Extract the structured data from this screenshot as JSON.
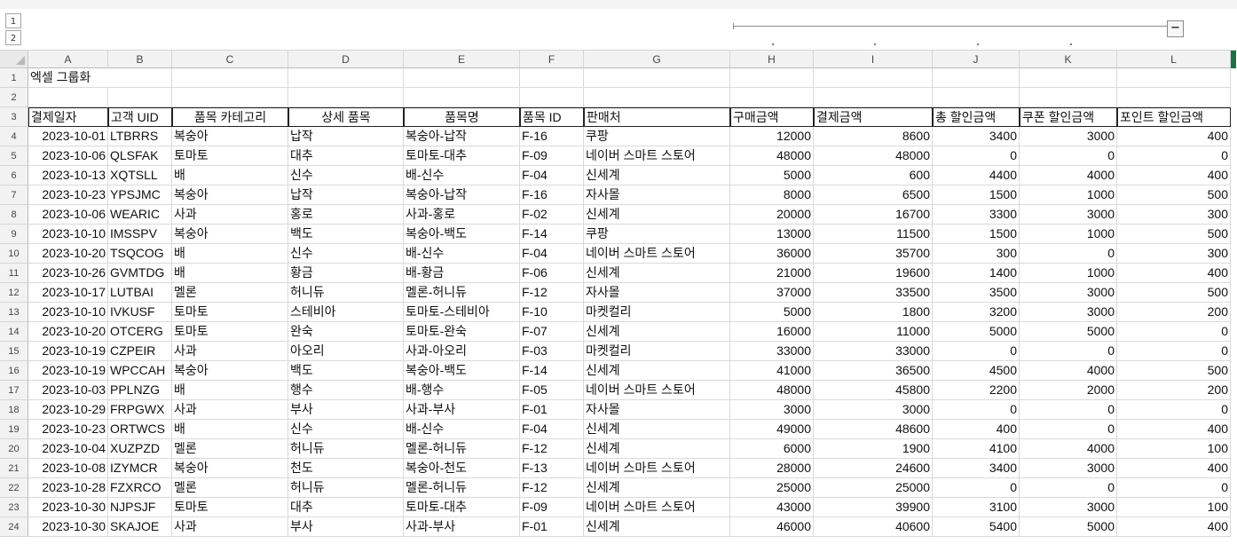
{
  "outline": {
    "levels": [
      "1",
      "2"
    ],
    "collapse_symbol": "−"
  },
  "columns": [
    "A",
    "B",
    "C",
    "D",
    "E",
    "F",
    "G",
    "H",
    "I",
    "J",
    "K",
    "L"
  ],
  "row_numbers": [
    "1",
    "2",
    "3",
    "4",
    "5",
    "6",
    "7",
    "8",
    "9",
    "10",
    "11",
    "12",
    "13",
    "14",
    "15",
    "16",
    "17",
    "18",
    "19",
    "20",
    "21",
    "22",
    "23",
    "24"
  ],
  "title": "엑셀 그룹화",
  "headers": [
    "결제일자",
    "고객 UID",
    "품목 카테고리",
    "상세 품목",
    "품목명",
    "품목 ID",
    "판매처",
    "구매금액",
    "결제금액",
    "총 할인금액",
    "쿠폰 할인금액",
    "포인트 할인금액"
  ],
  "rows": [
    [
      "2023-10-01",
      "LTBRRS",
      "복숭아",
      "납작",
      "복숭아-납작",
      "F-16",
      "쿠팡",
      "12000",
      "8600",
      "3400",
      "3000",
      "400"
    ],
    [
      "2023-10-06",
      "QLSFAK",
      "토마토",
      "대추",
      "토마토-대추",
      "F-09",
      "네이버 스마트 스토어",
      "48000",
      "48000",
      "0",
      "0",
      "0"
    ],
    [
      "2023-10-13",
      "XQTSLL",
      "배",
      "신수",
      "배-신수",
      "F-04",
      "신세계",
      "5000",
      "600",
      "4400",
      "4000",
      "400"
    ],
    [
      "2023-10-23",
      "YPSJMC",
      "복숭아",
      "납작",
      "복숭아-납작",
      "F-16",
      "자사몰",
      "8000",
      "6500",
      "1500",
      "1000",
      "500"
    ],
    [
      "2023-10-06",
      "WEARIC",
      "사과",
      "홍로",
      "사과-홍로",
      "F-02",
      "신세계",
      "20000",
      "16700",
      "3300",
      "3000",
      "300"
    ],
    [
      "2023-10-10",
      "IMSSPV",
      "복숭아",
      "백도",
      "복숭아-백도",
      "F-14",
      "쿠팡",
      "13000",
      "11500",
      "1500",
      "1000",
      "500"
    ],
    [
      "2023-10-20",
      "TSQCOG",
      "배",
      "신수",
      "배-신수",
      "F-04",
      "네이버 스마트 스토어",
      "36000",
      "35700",
      "300",
      "0",
      "300"
    ],
    [
      "2023-10-26",
      "GVMTDG",
      "배",
      "황금",
      "배-황금",
      "F-06",
      "신세계",
      "21000",
      "19600",
      "1400",
      "1000",
      "400"
    ],
    [
      "2023-10-17",
      "LUTBAI",
      "멜론",
      "허니듀",
      "멜론-허니듀",
      "F-12",
      "자사몰",
      "37000",
      "33500",
      "3500",
      "3000",
      "500"
    ],
    [
      "2023-10-10",
      "IVKUSF",
      "토마토",
      "스테비아",
      "토마토-스테비아",
      "F-10",
      "마켓컬리",
      "5000",
      "1800",
      "3200",
      "3000",
      "200"
    ],
    [
      "2023-10-20",
      "OTCERG",
      "토마토",
      "완숙",
      "토마토-완숙",
      "F-07",
      "신세계",
      "16000",
      "11000",
      "5000",
      "5000",
      "0"
    ],
    [
      "2023-10-19",
      "CZPEIR",
      "사과",
      "아오리",
      "사과-아오리",
      "F-03",
      "마켓컬리",
      "33000",
      "33000",
      "0",
      "0",
      "0"
    ],
    [
      "2023-10-19",
      "WPCCAH",
      "복숭아",
      "백도",
      "복숭아-백도",
      "F-14",
      "신세계",
      "41000",
      "36500",
      "4500",
      "4000",
      "500"
    ],
    [
      "2023-10-03",
      "PPLNZG",
      "배",
      "행수",
      "배-행수",
      "F-05",
      "네이버 스마트 스토어",
      "48000",
      "45800",
      "2200",
      "2000",
      "200"
    ],
    [
      "2023-10-29",
      "FRPGWX",
      "사과",
      "부사",
      "사과-부사",
      "F-01",
      "자사몰",
      "3000",
      "3000",
      "0",
      "0",
      "0"
    ],
    [
      "2023-10-23",
      "ORTWCS",
      "배",
      "신수",
      "배-신수",
      "F-04",
      "신세계",
      "49000",
      "48600",
      "400",
      "0",
      "400"
    ],
    [
      "2023-10-04",
      "XUZPZD",
      "멜론",
      "허니듀",
      "멜론-허니듀",
      "F-12",
      "신세계",
      "6000",
      "1900",
      "4100",
      "4000",
      "100"
    ],
    [
      "2023-10-08",
      "IZYMCR",
      "복숭아",
      "천도",
      "복숭아-천도",
      "F-13",
      "네이버 스마트 스토어",
      "28000",
      "24600",
      "3400",
      "3000",
      "400"
    ],
    [
      "2023-10-28",
      "FZXRCO",
      "멜론",
      "허니듀",
      "멜론-허니듀",
      "F-12",
      "신세계",
      "25000",
      "25000",
      "0",
      "0",
      "0"
    ],
    [
      "2023-10-30",
      "NJPSJF",
      "토마토",
      "대추",
      "토마토-대추",
      "F-09",
      "네이버 스마트 스토어",
      "43000",
      "39900",
      "3100",
      "3000",
      "100"
    ],
    [
      "2023-10-30",
      "SKAJOE",
      "사과",
      "부사",
      "사과-부사",
      "F-01",
      "신세계",
      "46000",
      "40600",
      "5400",
      "5000",
      "400"
    ]
  ]
}
